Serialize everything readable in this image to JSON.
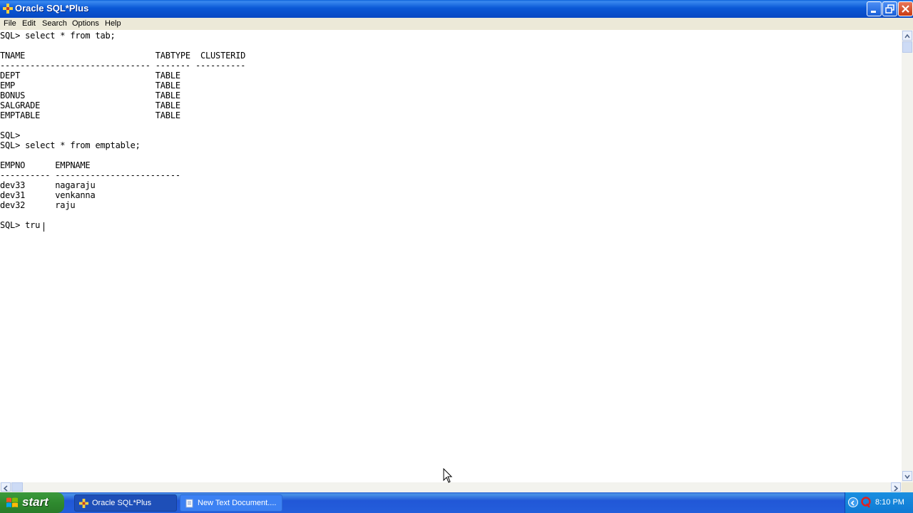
{
  "window": {
    "title": "Oracle SQL*Plus"
  },
  "menu": {
    "items": [
      "File",
      "Edit",
      "Search",
      "Options",
      "Help"
    ]
  },
  "console": {
    "lines": [
      "SQL> select * from tab;",
      "",
      "TNAME                          TABTYPE  CLUSTERID",
      "------------------------------ ------- ----------",
      "DEPT                           TABLE",
      "EMP                            TABLE",
      "BONUS                          TABLE",
      "SALGRADE                       TABLE",
      "EMPTABLE                       TABLE",
      "",
      "SQL>",
      "SQL> select * from emptable;",
      "",
      "EMPNO      EMPNAME",
      "---------- -------------------------",
      "dev33      nagaraju",
      "dev31      venkanna",
      "dev32      raju",
      "",
      "SQL> tru"
    ]
  },
  "taskbar": {
    "start_label": "start",
    "tasks": [
      {
        "label": "Oracle SQL*Plus",
        "active": true
      },
      {
        "label": "New Text Document....",
        "active": false
      }
    ],
    "clock": "8:10 PM"
  },
  "colors": {
    "titlebar": "#0a58d6",
    "menubar": "#ece9d8",
    "taskbar": "#245edb",
    "start": "#2f8a2f"
  }
}
